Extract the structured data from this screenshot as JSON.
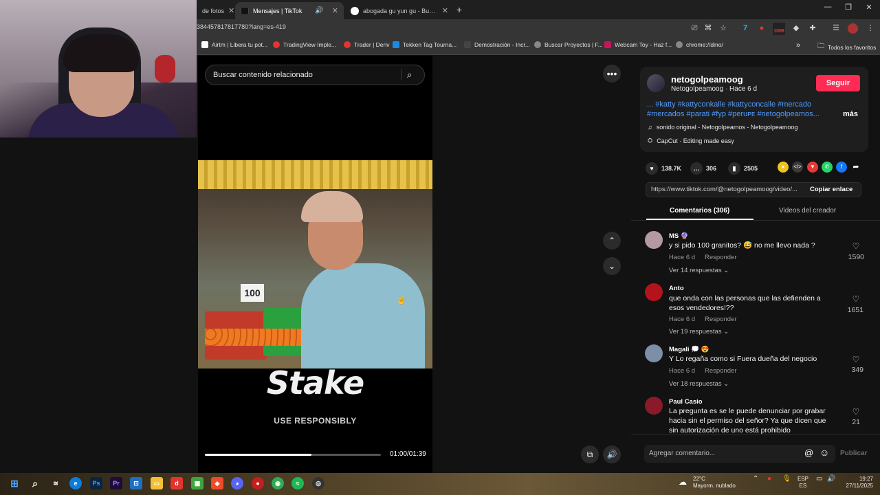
{
  "browser": {
    "tabs": [
      {
        "label": "de fotos",
        "active": false
      },
      {
        "label": "Mensajes | TikTok",
        "active": true
      },
      {
        "label": "abogada gu yun gu - Buscar co",
        "active": false
      }
    ],
    "new_tab": "+",
    "url": "384457817817780?lang=es-419",
    "bookmarks": [
      {
        "label": "Airtm | Libera tu pot...",
        "color": "#ffffff"
      },
      {
        "label": "TradingView Imple...",
        "color": "#e3342f"
      },
      {
        "label": "Trader | Deriv",
        "color": "#e3342f"
      },
      {
        "label": "Tekken Tag Tourna...",
        "color": "#1e88e5"
      },
      {
        "label": "Demostración - Incr...",
        "color": "#444444"
      },
      {
        "label": "Buscar Proyectos | F...",
        "color": "#888888"
      },
      {
        "label": "Webcam Toy - Haz f...",
        "color": "#c2185b"
      },
      {
        "label": "chrome://dino/",
        "color": "#888888"
      }
    ],
    "all_bookmarks": "Todos los favoritos",
    "toolbar_badge": "1006"
  },
  "video": {
    "search_placeholder": "Buscar contenido relacionado",
    "price_tag": "100",
    "overlay_logo": "Stake",
    "overlay_sub": "USE RESPONSIBLY",
    "progress": 0.605,
    "time": "01:00/01:39"
  },
  "post": {
    "username": "netogolpeamoog",
    "subline": "Netogolpeamoog · Hace 6 d",
    "follow": "Seguir",
    "description": "... #katty #kattyconkalle #kattyconcalle #mercado #mercados #parati #fyp #peruᴘᴇ #netogolpeamos...",
    "more": "más",
    "sound": "sonido original - Netogolpeamos - Netogolpeamoog",
    "capcut": "CapCut · Editing made easy",
    "likes": "138.7K",
    "comments": "306",
    "saves": "2505",
    "link": "https://www.tiktok.com/@netogolpeamoog/video/...",
    "copy": "Copiar enlace",
    "tab_comments": "Comentarios (306)",
    "tab_videos": "Videos del creador"
  },
  "comments": [
    {
      "name": "MS 🔮",
      "text": "y si pido 100 granitos? 😅 no me llevo nada ?",
      "time": "Hace 6 d",
      "reply": "Responder",
      "replies": "Ver 14 respuestas",
      "likes": "1590",
      "avatar": "#b49aa0"
    },
    {
      "name": "Anto",
      "text": "que onda con las personas que las defienden a esos vendedores!??",
      "time": "Hace 6 d",
      "reply": "Responder",
      "replies": "Ver 19 respuestas",
      "likes": "1651",
      "avatar": "#b3131b"
    },
    {
      "name": "Magali 💭 😍",
      "text": "Y Lo regaña como si Fuera dueña del negocio",
      "time": "Hace 6 d",
      "reply": "Responder",
      "replies": "Ver 18 respuestas",
      "likes": "349",
      "avatar": "#7d8fa8"
    },
    {
      "name": "Paul Casio",
      "text": "La pregunta es se le puede denunciar por grabar hacia sin el permiso del señor? Ya que dicen que sin autorización de uno está prohibido",
      "time": "",
      "reply": "",
      "replies": "",
      "likes": "21",
      "avatar": "#8a1a2a"
    }
  ],
  "comment_input": {
    "placeholder": "Agregar comentario...",
    "publish": "Publicar",
    "at": "@",
    "emoji": "☺"
  },
  "taskbar": {
    "weather_temp": "22°C",
    "weather_desc": "Mayorm. nublado",
    "lang_top": "ESP",
    "lang_bottom": "ES",
    "time": "19:27",
    "date": "27/11/2025"
  }
}
